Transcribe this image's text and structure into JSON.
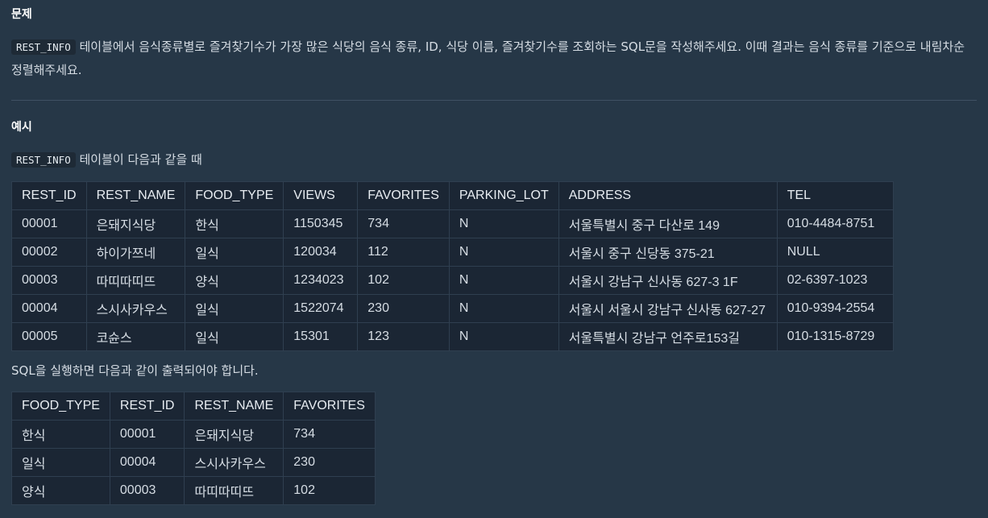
{
  "problem": {
    "heading": "문제",
    "code_table": "REST_INFO",
    "text_after_code": " 테이블에서 음식종류별로 즐겨찾기수가 가장 많은 식당의 음식 종류, ID, 식당 이름, 즐겨찾기수를 조회하는 SQL문을 작성해주세요. 이때 결과는 음식 종류를 기준으로 내림차순 정렬해주세요."
  },
  "example": {
    "heading": "예시",
    "code_table": "REST_INFO",
    "intro_after_code": " 테이블이 다음과 같을 때",
    "input_table": {
      "headers": [
        "REST_ID",
        "REST_NAME",
        "FOOD_TYPE",
        "VIEWS",
        "FAVORITES",
        "PARKING_LOT",
        "ADDRESS",
        "TEL"
      ],
      "rows": [
        [
          "00001",
          "은돼지식당",
          "한식",
          "1150345",
          "734",
          "N",
          "서울특별시 중구 다산로 149",
          "010-4484-8751"
        ],
        [
          "00002",
          "하이가쯔네",
          "일식",
          "120034",
          "112",
          "N",
          "서울시 중구 신당동 375-21",
          "NULL"
        ],
        [
          "00003",
          "따띠따띠뜨",
          "양식",
          "1234023",
          "102",
          "N",
          "서울시 강남구 신사동 627-3 1F",
          "02-6397-1023"
        ],
        [
          "00004",
          "스시사카우스",
          "일식",
          "1522074",
          "230",
          "N",
          "서울시 서울시 강남구 신사동 627-27",
          "010-9394-2554"
        ],
        [
          "00005",
          "코슌스",
          "일식",
          "15301",
          "123",
          "N",
          "서울특별시 강남구 언주로153길",
          "010-1315-8729"
        ]
      ]
    },
    "result_intro": "SQL을 실행하면 다음과 같이 출력되어야 합니다.",
    "output_table": {
      "headers": [
        "FOOD_TYPE",
        "REST_ID",
        "REST_NAME",
        "FAVORITES"
      ],
      "rows": [
        [
          "한식",
          "00001",
          "은돼지식당",
          "734"
        ],
        [
          "일식",
          "00004",
          "스시사카우스",
          "230"
        ],
        [
          "양식",
          "00003",
          "따띠따띠뜨",
          "102"
        ]
      ]
    }
  }
}
